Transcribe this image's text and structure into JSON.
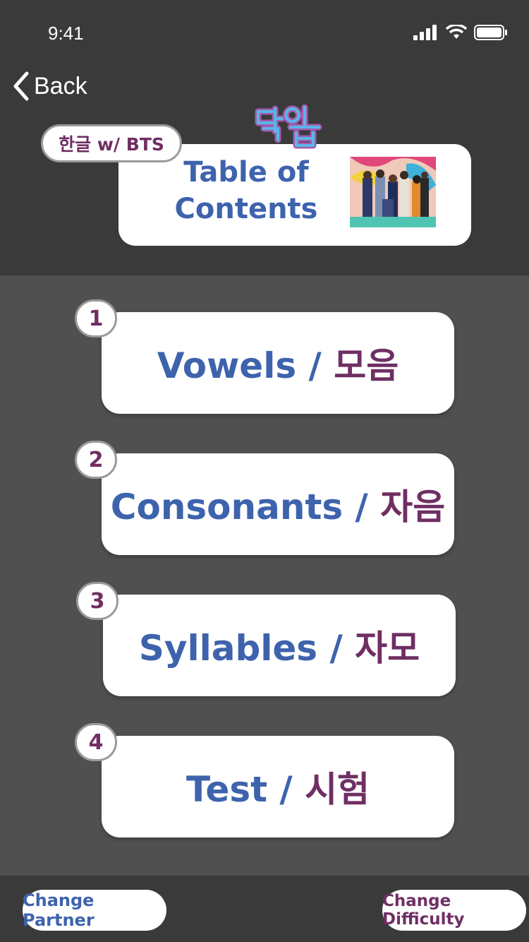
{
  "status_bar": {
    "time": "9:41"
  },
  "nav": {
    "back_label": "Back"
  },
  "brand": {
    "pill_label": "한글 w/ BTS",
    "logo_text": "덕업"
  },
  "toc": {
    "title": "Table of Contents"
  },
  "menu": [
    {
      "number": "1",
      "en": "Vowels",
      "sep": " / ",
      "ko": "모음"
    },
    {
      "number": "2",
      "en": "Consonants",
      "sep": " / ",
      "ko": "자음"
    },
    {
      "number": "3",
      "en": "Syllables",
      "sep": " / ",
      "ko": "자모"
    },
    {
      "number": "4",
      "en": "Test",
      "sep": " / ",
      "ko": "시험"
    }
  ],
  "footer": {
    "change_partner": "Change Partner",
    "change_difficulty": "Change Difficulty"
  },
  "colors": {
    "blue": "#3e63ad",
    "purple": "#6f2f63",
    "header_bg": "#3a3a3a",
    "main_bg": "#505050"
  }
}
